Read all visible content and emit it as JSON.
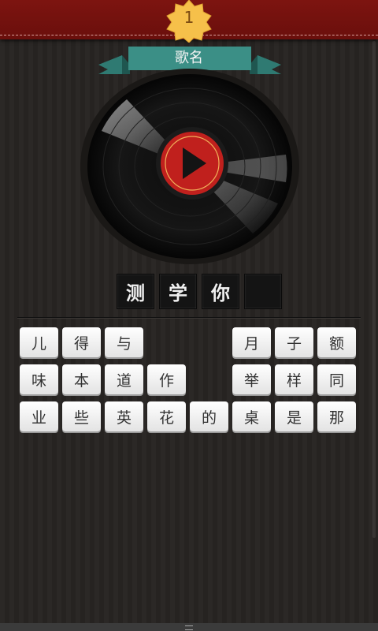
{
  "header": {
    "level": "1",
    "accent": "#7d1410",
    "badge_color": "#f6c04a"
  },
  "ribbon": {
    "title": "歌名",
    "color": "#3b8f86"
  },
  "answer": {
    "slots": [
      "测",
      "学",
      "你",
      ""
    ]
  },
  "keyboard": {
    "rows": [
      [
        "儿",
        "得",
        "与",
        "",
        "",
        "月",
        "子",
        "额"
      ],
      [
        "味",
        "本",
        "道",
        "作",
        "",
        "举",
        "样",
        "同"
      ],
      [
        "业",
        "些",
        "英",
        "花",
        "的",
        "桌",
        "是",
        "那"
      ]
    ]
  },
  "icons": {
    "play": "play-icon",
    "badge": "star-badge-icon",
    "disc": "vinyl-record-icon"
  }
}
